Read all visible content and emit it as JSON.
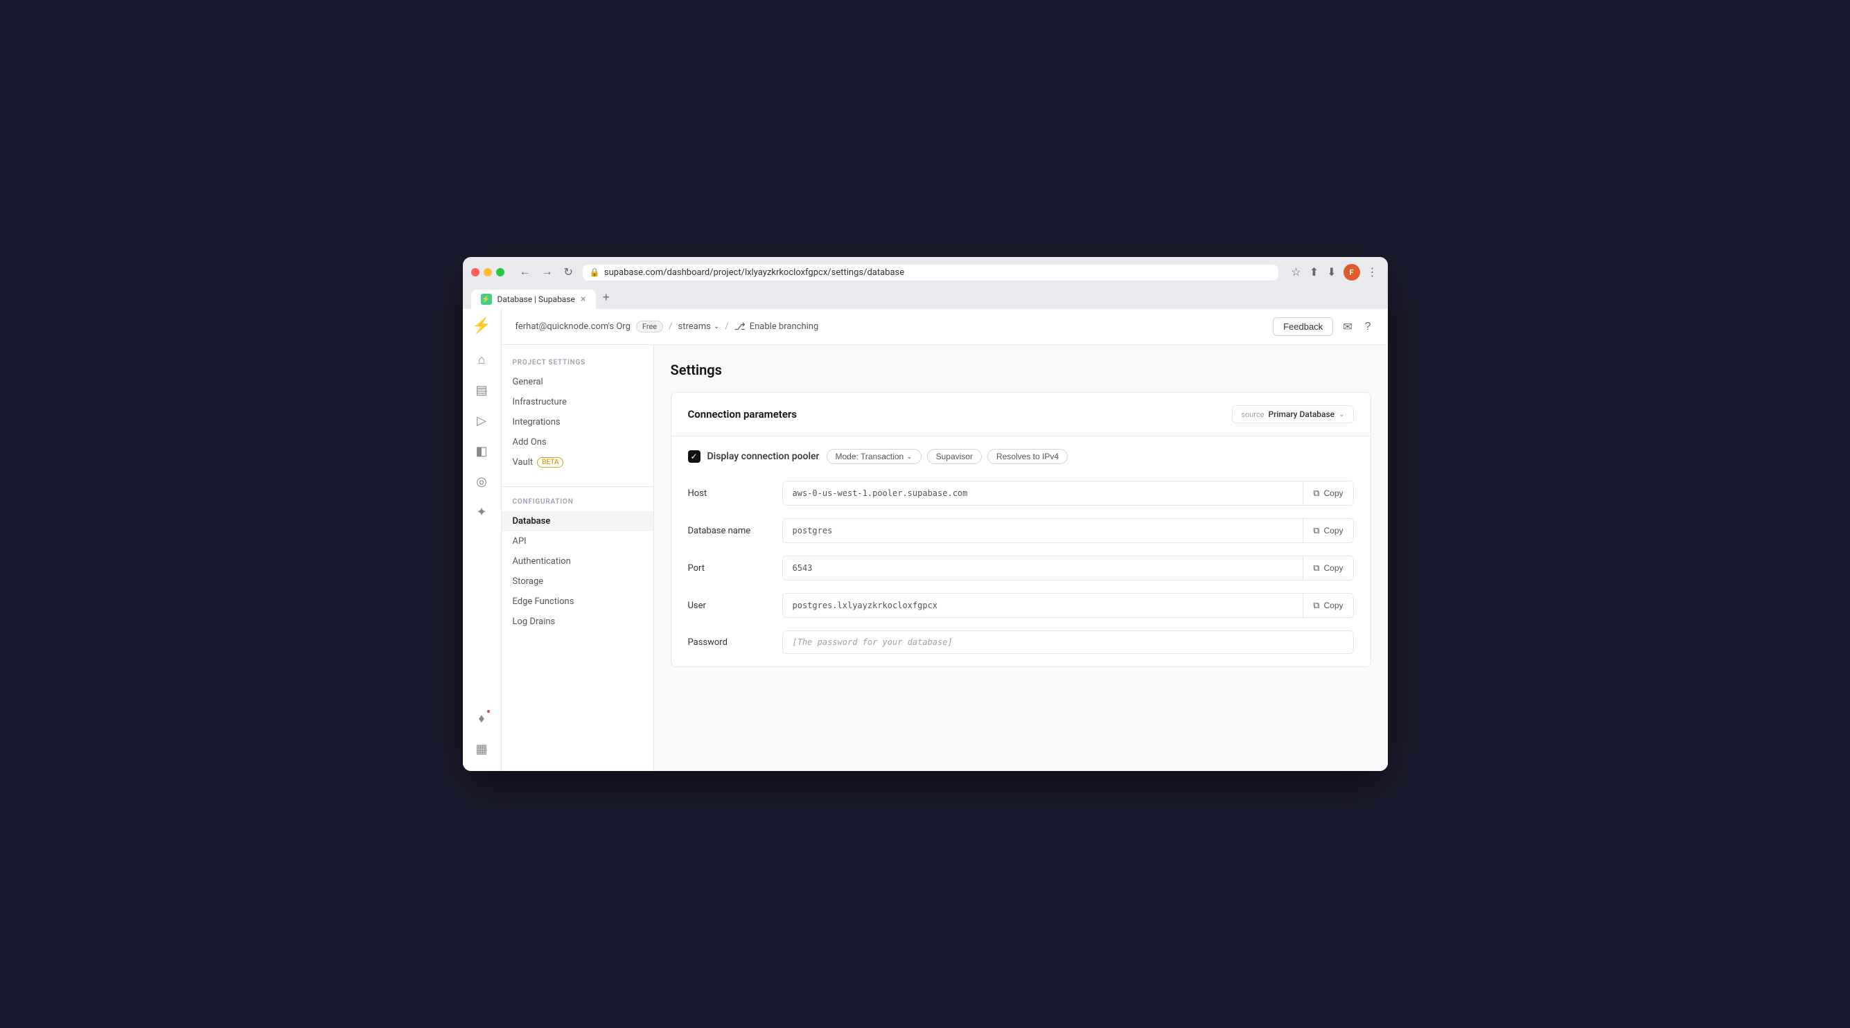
{
  "browser": {
    "url": "supabase.com/dashboard/project/lxlyayzkrkocloxfgpcx/settings/database",
    "tab_title": "Database | Supabase",
    "tab_favicon_text": "⚡",
    "close_symbol": "×",
    "new_tab_symbol": "+",
    "nav_back": "←",
    "nav_forward": "→",
    "nav_refresh": "↻"
  },
  "header": {
    "org_name": "ferhat@quicknode.com's Org",
    "plan_badge": "Free",
    "breadcrumb_sep1": "/",
    "streams_label": "streams",
    "breadcrumb_sep2": "/",
    "branch_label": "Enable branching",
    "feedback_label": "Feedback",
    "expand_icon": "⌄"
  },
  "sidebar": {
    "logo": "⚡",
    "items": [
      {
        "name": "home-icon",
        "icon": "⌂",
        "active": false
      },
      {
        "name": "table-icon",
        "icon": "▦",
        "active": false
      },
      {
        "name": "terminal-icon",
        "icon": "▶",
        "active": false
      },
      {
        "name": "storage-icon",
        "icon": "◫",
        "active": false
      },
      {
        "name": "auth-icon",
        "icon": "◎",
        "active": false
      },
      {
        "name": "realtime-icon",
        "icon": "✦",
        "active": false
      }
    ],
    "bottom_items": [
      {
        "name": "notification-icon",
        "icon": "♦",
        "has_badge": true
      },
      {
        "name": "chart-icon",
        "icon": "▦",
        "has_badge": false
      }
    ]
  },
  "settings_nav": {
    "project_settings_title": "PROJECT SETTINGS",
    "project_items": [
      {
        "label": "General",
        "active": false
      },
      {
        "label": "Infrastructure",
        "active": false
      },
      {
        "label": "Integrations",
        "active": false
      },
      {
        "label": "Add Ons",
        "active": false
      },
      {
        "label": "Vault",
        "active": false,
        "badge": "BETA"
      }
    ],
    "configuration_title": "CONFIGURATION",
    "config_items": [
      {
        "label": "Database",
        "active": true
      },
      {
        "label": "API",
        "active": false
      },
      {
        "label": "Authentication",
        "active": false
      },
      {
        "label": "Storage",
        "active": false
      },
      {
        "label": "Edge Functions",
        "active": false
      },
      {
        "label": "Log Drains",
        "active": false
      }
    ]
  },
  "page": {
    "title": "Settings"
  },
  "connection_card": {
    "title": "Connection parameters",
    "source_label": "source",
    "source_value": "Primary Database",
    "pooler_label": "Display connection pooler",
    "pooler_mode_label": "Mode: Transaction",
    "pooler_supervisor_label": "Supavisor",
    "pooler_ipv4_label": "Resolves to IPv4",
    "fields": [
      {
        "name": "host-field",
        "label": "Host",
        "value": "aws-0-us-west-1.pooler.supabase.com",
        "placeholder": "",
        "copy_label": "Copy",
        "has_copy": true
      },
      {
        "name": "dbname-field",
        "label": "Database name",
        "value": "postgres",
        "placeholder": "",
        "copy_label": "Copy",
        "has_copy": true
      },
      {
        "name": "port-field",
        "label": "Port",
        "value": "6543",
        "placeholder": "",
        "copy_label": "Copy",
        "has_copy": true
      },
      {
        "name": "user-field",
        "label": "User",
        "value": "postgres.lxlyayzkrkocloxfgpcx",
        "placeholder": "",
        "copy_label": "Copy",
        "has_copy": true
      },
      {
        "name": "password-field",
        "label": "Password",
        "value": "",
        "placeholder": "[The password for your database]",
        "has_copy": false
      }
    ]
  }
}
